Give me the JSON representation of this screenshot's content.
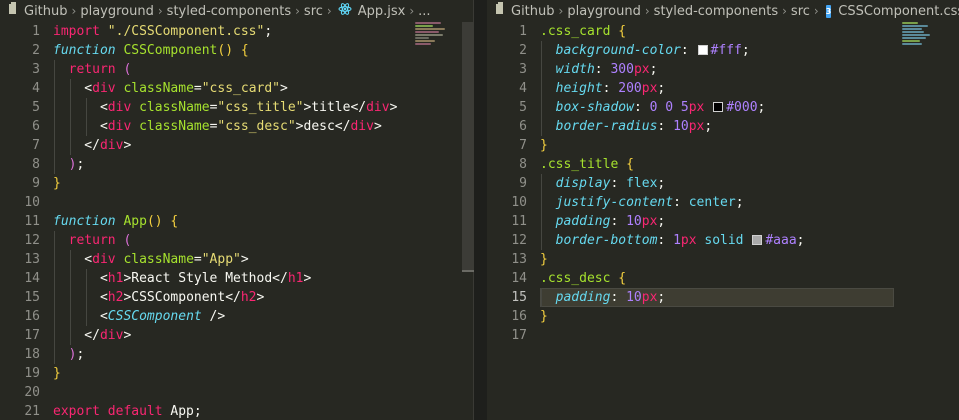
{
  "left_editor": {
    "breadcrumb": [
      "Github",
      "playground",
      "styled-components",
      "src",
      "App.jsx",
      "..."
    ],
    "line_numbers": [
      "1",
      "2",
      "3",
      "4",
      "5",
      "6",
      "7",
      "8",
      "9",
      "10",
      "11",
      "12",
      "13",
      "14",
      "15",
      "16",
      "17",
      "18",
      "19",
      "20",
      "21"
    ],
    "lines": [
      {
        "t": [
          [
            "kw",
            "import "
          ],
          [
            "str",
            "\"./CSSComponent.css\""
          ],
          [
            "pun",
            ";"
          ]
        ]
      },
      {
        "t": [
          [
            "fnkw",
            "function "
          ],
          [
            "fn",
            "CSSComponent"
          ],
          [
            "br",
            "() "
          ],
          [
            "br",
            "{"
          ]
        ]
      },
      {
        "t": [
          [
            "pun",
            "  "
          ],
          [
            "kw",
            "return "
          ],
          [
            "br2",
            "("
          ]
        ]
      },
      {
        "t": [
          [
            "pun",
            "    <"
          ],
          [
            "tag",
            "div "
          ],
          [
            "attr",
            "className"
          ],
          [
            "pun",
            "="
          ],
          [
            "str",
            "\"css_card\""
          ],
          [
            "pun",
            ">"
          ]
        ]
      },
      {
        "t": [
          [
            "pun",
            "      <"
          ],
          [
            "tag",
            "div "
          ],
          [
            "attr",
            "className"
          ],
          [
            "pun",
            "="
          ],
          [
            "str",
            "\"css_title\""
          ],
          [
            "pun",
            ">title</"
          ],
          [
            "tag",
            "div"
          ],
          [
            "pun",
            ">"
          ]
        ]
      },
      {
        "t": [
          [
            "pun",
            "      <"
          ],
          [
            "tag",
            "div "
          ],
          [
            "attr",
            "className"
          ],
          [
            "pun",
            "="
          ],
          [
            "str",
            "\"css_desc\""
          ],
          [
            "pun",
            ">desc</"
          ],
          [
            "tag",
            "div"
          ],
          [
            "pun",
            ">"
          ]
        ]
      },
      {
        "t": [
          [
            "pun",
            "    </"
          ],
          [
            "tag",
            "div"
          ],
          [
            "pun",
            ">"
          ]
        ]
      },
      {
        "t": [
          [
            "pun",
            "  "
          ],
          [
            "br2",
            ")"
          ],
          [
            "pun",
            ";"
          ]
        ]
      },
      {
        "t": [
          [
            "br",
            "}"
          ]
        ]
      },
      {
        "t": []
      },
      {
        "t": [
          [
            "fnkw",
            "function "
          ],
          [
            "fn",
            "App"
          ],
          [
            "br",
            "() "
          ],
          [
            "br",
            "{"
          ]
        ]
      },
      {
        "t": [
          [
            "pun",
            "  "
          ],
          [
            "kw",
            "return "
          ],
          [
            "br2",
            "("
          ]
        ]
      },
      {
        "t": [
          [
            "pun",
            "    <"
          ],
          [
            "tag",
            "div "
          ],
          [
            "attr",
            "className"
          ],
          [
            "pun",
            "="
          ],
          [
            "str",
            "\"App\""
          ],
          [
            "pun",
            ">"
          ]
        ]
      },
      {
        "t": [
          [
            "pun",
            "      <"
          ],
          [
            "tag",
            "h1"
          ],
          [
            "pun",
            ">React Style Method</"
          ],
          [
            "tag",
            "h1"
          ],
          [
            "pun",
            ">"
          ]
        ]
      },
      {
        "t": [
          [
            "pun",
            "      <"
          ],
          [
            "tag",
            "h2"
          ],
          [
            "pun",
            ">CSSComponent</"
          ],
          [
            "tag",
            "h2"
          ],
          [
            "pun",
            ">"
          ]
        ]
      },
      {
        "t": [
          [
            "pun",
            "      <"
          ],
          [
            "comp",
            "CSSComponent"
          ],
          [
            "pun",
            " />"
          ]
        ]
      },
      {
        "t": [
          [
            "pun",
            "    </"
          ],
          [
            "tag",
            "div"
          ],
          [
            "pun",
            ">"
          ]
        ]
      },
      {
        "t": [
          [
            "pun",
            "  "
          ],
          [
            "br2",
            ")"
          ],
          [
            "pun",
            ";"
          ]
        ]
      },
      {
        "t": [
          [
            "br",
            "}"
          ]
        ]
      },
      {
        "t": []
      },
      {
        "t": [
          [
            "kw",
            "export default "
          ],
          [
            "pun",
            "App;"
          ]
        ]
      }
    ]
  },
  "right_editor": {
    "breadcrumb": [
      "Github",
      "playground",
      "styled-components",
      "src",
      "CSSComponent.css"
    ],
    "current_line": "15",
    "line_numbers": [
      "1",
      "2",
      "3",
      "4",
      "5",
      "6",
      "7",
      "8",
      "9",
      "10",
      "11",
      "12",
      "13",
      "14",
      "15",
      "16",
      "17"
    ],
    "lines": [
      {
        "t": [
          [
            "sel",
            ".css_card "
          ],
          [
            "br",
            "{"
          ]
        ]
      },
      {
        "t": [
          [
            "pun",
            "  "
          ],
          [
            "prop",
            "background-color"
          ],
          [
            "pun",
            ": "
          ],
          [
            "swatch",
            "#ffffff"
          ],
          [
            "num",
            "#fff"
          ],
          [
            "pun",
            ";"
          ]
        ]
      },
      {
        "t": [
          [
            "pun",
            "  "
          ],
          [
            "prop",
            "width"
          ],
          [
            "pun",
            ": "
          ],
          [
            "num",
            "300"
          ],
          [
            "unit",
            "px"
          ],
          [
            "pun",
            ";"
          ]
        ]
      },
      {
        "t": [
          [
            "pun",
            "  "
          ],
          [
            "prop",
            "height"
          ],
          [
            "pun",
            ": "
          ],
          [
            "num",
            "200"
          ],
          [
            "unit",
            "px"
          ],
          [
            "pun",
            ";"
          ]
        ]
      },
      {
        "t": [
          [
            "pun",
            "  "
          ],
          [
            "prop",
            "box-shadow"
          ],
          [
            "pun",
            ": "
          ],
          [
            "num",
            "0 0 5"
          ],
          [
            "unit",
            "px "
          ],
          [
            "swatch",
            "#000000"
          ],
          [
            "num",
            "#000"
          ],
          [
            "pun",
            ";"
          ]
        ]
      },
      {
        "t": [
          [
            "pun",
            "  "
          ],
          [
            "prop",
            "border-radius"
          ],
          [
            "pun",
            ": "
          ],
          [
            "num",
            "10"
          ],
          [
            "unit",
            "px"
          ],
          [
            "pun",
            ";"
          ]
        ]
      },
      {
        "t": [
          [
            "br",
            "}"
          ]
        ]
      },
      {
        "t": [
          [
            "sel",
            ".css_title "
          ],
          [
            "br",
            "{"
          ]
        ]
      },
      {
        "t": [
          [
            "pun",
            "  "
          ],
          [
            "prop",
            "display"
          ],
          [
            "pun",
            ": "
          ],
          [
            "val",
            "flex"
          ],
          [
            "pun",
            ";"
          ]
        ]
      },
      {
        "t": [
          [
            "pun",
            "  "
          ],
          [
            "prop",
            "justify-content"
          ],
          [
            "pun",
            ": "
          ],
          [
            "val",
            "center"
          ],
          [
            "pun",
            ";"
          ]
        ]
      },
      {
        "t": [
          [
            "pun",
            "  "
          ],
          [
            "prop",
            "padding"
          ],
          [
            "pun",
            ": "
          ],
          [
            "num",
            "10"
          ],
          [
            "unit",
            "px"
          ],
          [
            "pun",
            ";"
          ]
        ]
      },
      {
        "t": [
          [
            "pun",
            "  "
          ],
          [
            "prop",
            "border-bottom"
          ],
          [
            "pun",
            ": "
          ],
          [
            "num",
            "1"
          ],
          [
            "unit",
            "px "
          ],
          [
            "val",
            "solid "
          ],
          [
            "swatch",
            "#aaaaaa"
          ],
          [
            "num",
            "#aaa"
          ],
          [
            "pun",
            ";"
          ]
        ]
      },
      {
        "t": [
          [
            "br",
            "}"
          ]
        ]
      },
      {
        "t": [
          [
            "sel",
            ".css_desc "
          ],
          [
            "br",
            "{"
          ]
        ]
      },
      {
        "t": [
          [
            "pun",
            "  "
          ],
          [
            "prop",
            "padding"
          ],
          [
            "pun",
            ": "
          ],
          [
            "num",
            "10"
          ],
          [
            "unit",
            "px"
          ],
          [
            "pun",
            ";"
          ]
        ]
      },
      {
        "t": [
          [
            "br",
            "}"
          ]
        ]
      },
      {
        "t": []
      }
    ]
  },
  "colors": {
    "editor_bg": "#272822",
    "keyword": "#f92672",
    "function": "#a6e22e",
    "string": "#e6db74",
    "number": "#ae81ff",
    "property": "#66d9ef"
  },
  "icons": [
    "folder-icon",
    "react-icon",
    "css-file-icon",
    "chevron-right-icon"
  ]
}
